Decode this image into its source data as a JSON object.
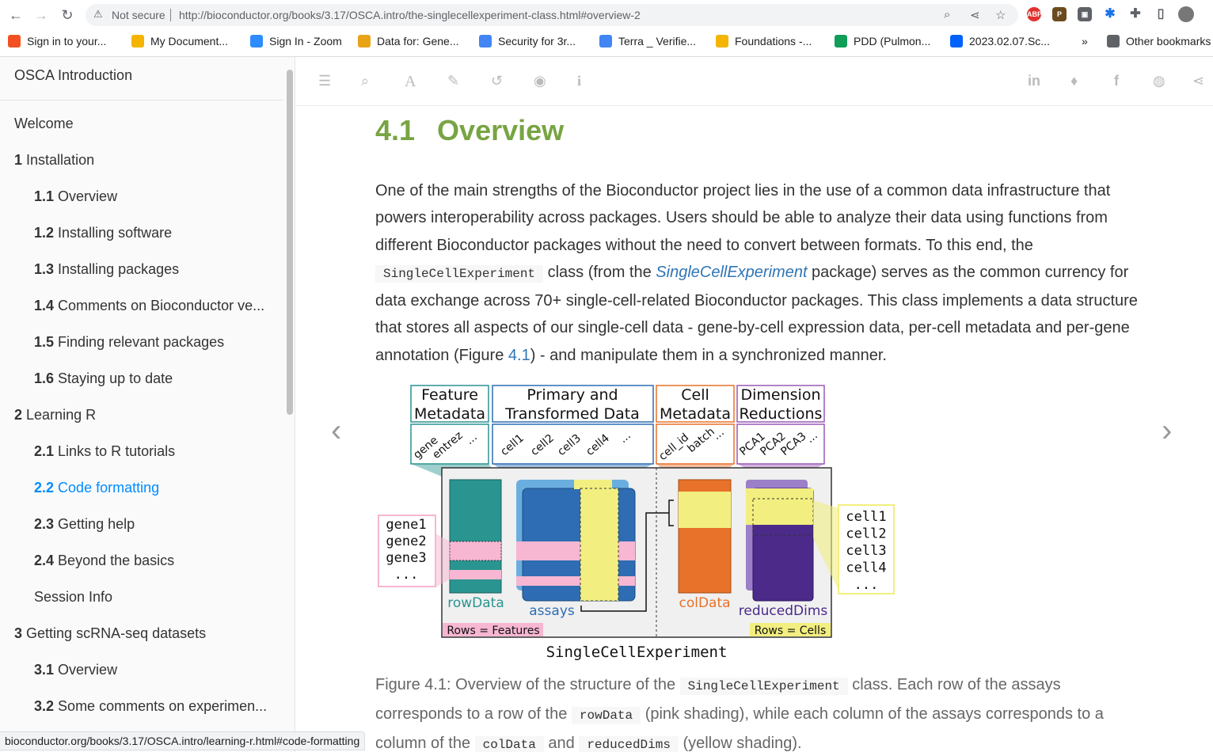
{
  "browser": {
    "security_label": "Not secure",
    "url": "http://bioconductor.org/books/3.17/OSCA.intro/the-singlecellexperiment-class.html#overview-2",
    "bookmarks": [
      {
        "label": "Sign in to your...",
        "color": "#f25022",
        "icon": "microsoft-icon"
      },
      {
        "label": "My Document...",
        "color": "#f4b400",
        "icon": "document-icon"
      },
      {
        "label": "Sign In - Zoom",
        "color": "#2d8cff",
        "icon": "zoom-icon"
      },
      {
        "label": "Data for: Gene...",
        "color": "#e8a317",
        "icon": "data-icon"
      },
      {
        "label": "Security for 3r...",
        "color": "#4285f4",
        "icon": "docs-icon"
      },
      {
        "label": "Terra _ Verifie...",
        "color": "#4285f4",
        "icon": "docs-icon"
      },
      {
        "label": "Foundations -...",
        "color": "#f4b400",
        "icon": "slides-icon"
      },
      {
        "label": "PDD (Pulmon...",
        "color": "#0f9d58",
        "icon": "sheets-icon"
      },
      {
        "label": "2023.02.07.Sc...",
        "color": "#0061fe",
        "icon": "dropbox-icon"
      }
    ],
    "other_bookmarks": "Other bookmarks",
    "more_chevron": "»",
    "status_url": "bioconductor.org/books/3.17/OSCA.intro/learning-r.html#code-formatting"
  },
  "sidebar": {
    "book_title": "OSCA Introduction",
    "items": [
      {
        "num": "",
        "label": "Welcome",
        "level": 0,
        "active": false
      },
      {
        "num": "1",
        "label": "Installation",
        "level": 0,
        "active": false
      },
      {
        "num": "1.1",
        "label": "Overview",
        "level": 1,
        "active": false
      },
      {
        "num": "1.2",
        "label": "Installing software",
        "level": 1,
        "active": false
      },
      {
        "num": "1.3",
        "label": "Installing packages",
        "level": 1,
        "active": false
      },
      {
        "num": "1.4",
        "label": "Comments on Bioconductor ve...",
        "level": 1,
        "active": false
      },
      {
        "num": "1.5",
        "label": "Finding relevant packages",
        "level": 1,
        "active": false
      },
      {
        "num": "1.6",
        "label": "Staying up to date",
        "level": 1,
        "active": false
      },
      {
        "num": "2",
        "label": "Learning R",
        "level": 0,
        "active": false
      },
      {
        "num": "2.1",
        "label": "Links to R tutorials",
        "level": 1,
        "active": false
      },
      {
        "num": "2.2",
        "label": "Code formatting",
        "level": 1,
        "active": true
      },
      {
        "num": "2.3",
        "label": "Getting help",
        "level": 1,
        "active": false
      },
      {
        "num": "2.4",
        "label": "Beyond the basics",
        "level": 1,
        "active": false
      },
      {
        "num": "",
        "label": "Session Info",
        "level": 1,
        "active": false
      },
      {
        "num": "3",
        "label": "Getting scRNA-seq datasets",
        "level": 0,
        "active": false
      },
      {
        "num": "3.1",
        "label": "Overview",
        "level": 1,
        "active": false
      },
      {
        "num": "3.2",
        "label": "Some comments on experimen...",
        "level": 1,
        "active": false
      }
    ]
  },
  "section": {
    "number": "4.1",
    "title": "Overview"
  },
  "paragraph": {
    "t1": "One of the main strengths of the Bioconductor project lies in the use of a common data infrastructure that powers interoperability across packages. Users should be able to analyze their data using functions from different Bioconductor packages without the need to convert between formats. To this end, the ",
    "code1": "SingleCellExperiment",
    "t2": " class (from the ",
    "pkg": "SingleCellExperiment",
    "t3": " package) serves as the common currency for data exchange across 70+ single-cell-related Bioconductor packages. This class implements a data structure that stores all aspects of our single-cell data - gene-by-cell expression data, per-cell metadata and per-gene annotation (Figure ",
    "figref": "4.1",
    "t4": ") - and manipulate them in a synchronized manner."
  },
  "figure": {
    "headers": {
      "feature_l1": "Feature",
      "feature_l2": "Metadata",
      "primary_l1": "Primary and",
      "primary_l2": "Transformed Data",
      "cell_l1": "Cell",
      "cell_l2": "Metadata",
      "dim_l1": "Dimension",
      "dim_l2": "Reductions"
    },
    "labels": {
      "gene": "gene",
      "entrez": "entrez",
      "cell1": "cell1",
      "cell2": "cell2",
      "cell3": "cell3",
      "cell4": "cell4",
      "cell_id": "cell_id",
      "batch": "batch",
      "pca1": "PCA1",
      "pca2": "PCA2",
      "pca3": "PCA3",
      "ellipsis": "..."
    },
    "genes": [
      "gene1",
      "gene2",
      "gene3",
      "..."
    ],
    "cells": [
      "cell1",
      "cell2",
      "cell3",
      "cell4",
      "..."
    ],
    "slots": {
      "rowData": "rowData",
      "assays": "assays",
      "colData": "colData",
      "reducedDims": "reducedDims"
    },
    "rows_features": "Rows = Features",
    "rows_cells": "Rows = Cells",
    "class_name": "SingleCellExperiment",
    "colors": {
      "feature": "#2a9490",
      "primary": "#2e6db3",
      "cell": "#e8722a",
      "dim": "#5b3696",
      "pink": "#f7b6d2",
      "yellow": "#f2ef80"
    }
  },
  "caption": {
    "t1": "Figure 4.1: Overview of the structure of the ",
    "code1": "SingleCellExperiment",
    "t2": " class. Each row of the assays corresponds to a row of the ",
    "code2": "rowData",
    "t3": " (pink shading), while each column of the assays corresponds to a column of the ",
    "code3": "colData",
    "t4": " and ",
    "code4": "reducedDims",
    "t5": " (yellow shading)."
  }
}
